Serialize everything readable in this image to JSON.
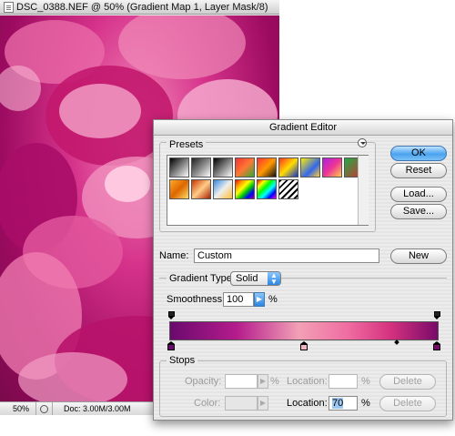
{
  "document": {
    "title": "DSC_0388.NEF @ 50% (Gradient Map 1, Layer Mask/8)",
    "zoom": "50%",
    "doc_size": "Doc: 3.00M/3.00M"
  },
  "dialog": {
    "title": "Gradient Editor",
    "presets_label": "Presets",
    "buttons": {
      "ok": "OK",
      "reset": "Reset",
      "load": "Load...",
      "save": "Save...",
      "new": "New"
    },
    "name_label": "Name:",
    "name_value": "Custom",
    "gradient_type_label": "Gradient Type:",
    "gradient_type_value": "Solid",
    "smoothness_label": "Smoothness:",
    "smoothness_value": "100",
    "smoothness_unit": "%",
    "stops": {
      "label": "Stops",
      "opacity_label": "Opacity:",
      "opacity_value": "",
      "opacity_unit": "%",
      "opacity_location_label": "Location:",
      "opacity_location_value": "",
      "opacity_location_unit": "%",
      "delete_label": "Delete",
      "color_label": "Color:",
      "color_location_label": "Location:",
      "color_location_value": "70",
      "color_location_unit": "%"
    },
    "gradient_colors": [
      "#6a0a6e",
      "#b51c8c",
      "#f2a0b6",
      "#f06ea2",
      "#d6337f",
      "#7a0a6a"
    ],
    "accent_color": "#4aa3ef"
  }
}
